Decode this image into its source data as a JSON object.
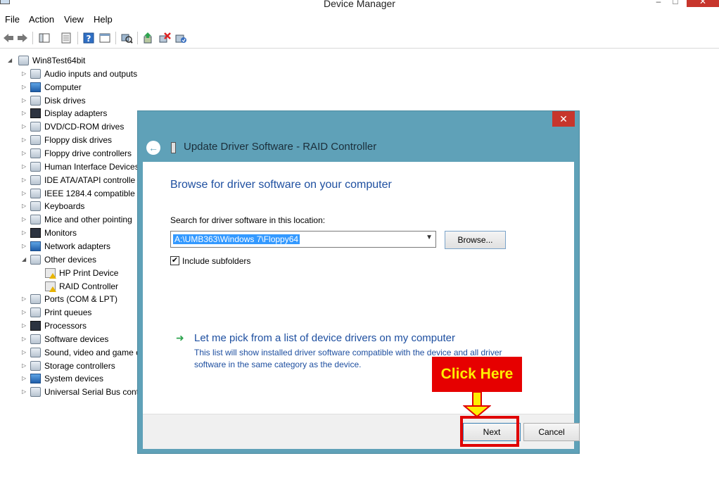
{
  "window": {
    "title": "Device Manager",
    "min_glyph": "–",
    "max_glyph": "□",
    "close_glyph": "✕"
  },
  "menubar": {
    "items": [
      "File",
      "Action",
      "View",
      "Help"
    ]
  },
  "tree": {
    "root": "Win8Test64bit",
    "items": [
      {
        "label": "Audio inputs and outputs",
        "icon": "speaker-icon"
      },
      {
        "label": "Computer",
        "icon": "computer-icon"
      },
      {
        "label": "Disk drives",
        "icon": "disk-drive-icon"
      },
      {
        "label": "Display adapters",
        "icon": "display-adapter-icon"
      },
      {
        "label": "DVD/CD-ROM drives",
        "icon": "dvd-drive-icon"
      },
      {
        "label": "Floppy disk drives",
        "icon": "floppy-drive-icon"
      },
      {
        "label": "Floppy drive controllers",
        "icon": "floppy-controller-icon"
      },
      {
        "label": "Human Interface Devices",
        "icon": "hid-icon"
      },
      {
        "label": "IDE ATA/ATAPI controlle",
        "icon": "ide-controller-icon"
      },
      {
        "label": "IEEE 1284.4 compatible p",
        "icon": "printer-icon"
      },
      {
        "label": "Keyboards",
        "icon": "keyboard-icon"
      },
      {
        "label": "Mice and other pointing",
        "icon": "mouse-icon"
      },
      {
        "label": "Monitors",
        "icon": "monitor-icon"
      },
      {
        "label": "Network adapters",
        "icon": "network-icon"
      },
      {
        "label": "Other devices",
        "icon": "other-devices-icon"
      },
      {
        "label": "HP Print Device",
        "icon": "warning-device-icon",
        "child": true
      },
      {
        "label": "RAID Controller",
        "icon": "warning-device-icon",
        "child": true
      },
      {
        "label": "Ports (COM & LPT)",
        "icon": "port-icon"
      },
      {
        "label": "Print queues",
        "icon": "printer-icon"
      },
      {
        "label": "Processors",
        "icon": "processor-icon"
      },
      {
        "label": "Software devices",
        "icon": "software-device-icon"
      },
      {
        "label": "Sound, video and game c",
        "icon": "speaker-icon"
      },
      {
        "label": "Storage controllers",
        "icon": "storage-icon"
      },
      {
        "label": "System devices",
        "icon": "system-device-icon"
      },
      {
        "label": "Universal Serial Bus contr",
        "icon": "usb-icon"
      }
    ]
  },
  "dialog": {
    "close_glyph": "✕",
    "title": "Update Driver Software - RAID Controller",
    "heading": "Browse for driver software on your computer",
    "search_label": "Search for driver software in this location:",
    "path_value": "A:\\UMB363\\Windows 7\\Floppy64",
    "browse_label": "Browse...",
    "include_subfolders_label": "Include subfolders",
    "include_subfolders_checked": true,
    "pick_link": "Let me pick from a list of device drivers on my computer",
    "pick_desc": "This list will show installed driver software compatible with the device and all driver software in the same category as the device.",
    "next_label": "Next",
    "cancel_label": "Cancel"
  },
  "annotation": {
    "label": "Click Here",
    "color": "#e60000",
    "text_color": "#ffee00"
  }
}
